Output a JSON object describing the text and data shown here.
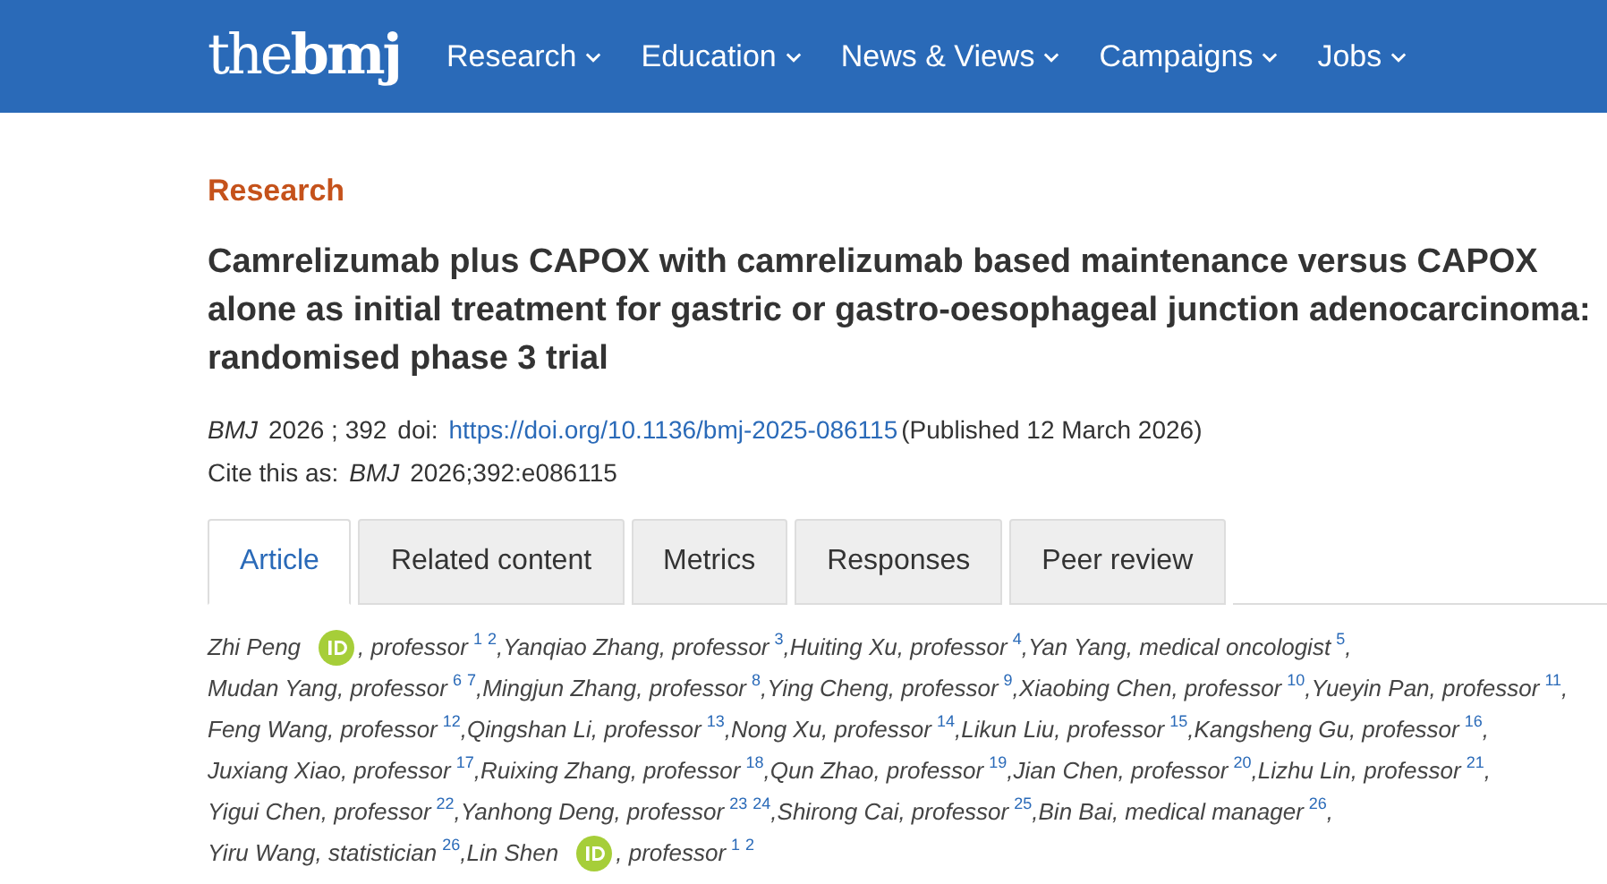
{
  "header": {
    "logo_light": "the",
    "logo_bold": "bmj",
    "nav": [
      {
        "label": "Research"
      },
      {
        "label": "Education"
      },
      {
        "label": "News & Views"
      },
      {
        "label": "Campaigns"
      },
      {
        "label": "Jobs"
      }
    ]
  },
  "article": {
    "section": "Research",
    "title_lines": [
      "Camrelizumab plus CAPOX with camrelizumab based maintenance versus CAPOX",
      "alone as initial treatment for gastric or gastro-oesophageal junction adenocarcinoma:",
      "randomised phase 3 trial"
    ],
    "citation": {
      "journal": "BMJ",
      "volume": "2026 ; 392",
      "doi_label": "doi:",
      "doi": "https://doi.org/10.1136/bmj-2025-086115",
      "published": "(Published 12 March 2026)"
    },
    "cite_as": {
      "label": "Cite this as:",
      "journal": "BMJ",
      "ref": "2026;392:e086115"
    },
    "tabs": [
      {
        "label": "Article",
        "selected": true
      },
      {
        "label": "Related content",
        "selected": false
      },
      {
        "label": "Metrics",
        "selected": false
      },
      {
        "label": "Responses",
        "selected": false
      },
      {
        "label": "Peer review",
        "selected": false
      }
    ],
    "author_lines": [
      [
        {
          "name": "Zhi Peng",
          "orcid": true,
          "role": ", professor",
          "sups": [
            "1",
            "2"
          ],
          "sep": ","
        },
        {
          "name": "Yanqiao Zhang, professor",
          "orcid": false,
          "sups": [
            "3"
          ],
          "sep": ","
        },
        {
          "name": "Huiting Xu, professor",
          "orcid": false,
          "sups": [
            "4"
          ],
          "sep": ","
        },
        {
          "name": "Yan Yang, medical oncologist",
          "orcid": false,
          "sups": [
            "5"
          ],
          "sep": ","
        }
      ],
      [
        {
          "name": "Mudan Yang, professor",
          "orcid": false,
          "sups": [
            "6",
            "7"
          ],
          "sep": ","
        },
        {
          "name": "Mingjun Zhang, professor",
          "orcid": false,
          "sups": [
            "8"
          ],
          "sep": ","
        },
        {
          "name": "Ying Cheng, professor",
          "orcid": false,
          "sups": [
            "9"
          ],
          "sep": ","
        },
        {
          "name": "Xiaobing Chen, professor",
          "orcid": false,
          "sups": [
            "10"
          ],
          "sep": ","
        },
        {
          "name": "Yueyin Pan, professor",
          "orcid": false,
          "sups": [
            "11"
          ],
          "sep": ","
        }
      ],
      [
        {
          "name": "Feng Wang, professor",
          "orcid": false,
          "sups": [
            "12"
          ],
          "sep": ","
        },
        {
          "name": "Qingshan Li, professor",
          "orcid": false,
          "sups": [
            "13"
          ],
          "sep": ","
        },
        {
          "name": "Nong Xu, professor",
          "orcid": false,
          "sups": [
            "14"
          ],
          "sep": ","
        },
        {
          "name": "Likun Liu, professor",
          "orcid": false,
          "sups": [
            "15"
          ],
          "sep": ","
        },
        {
          "name": "Kangsheng Gu, professor",
          "orcid": false,
          "sups": [
            "16"
          ],
          "sep": ","
        }
      ],
      [
        {
          "name": "Juxiang Xiao, professor",
          "orcid": false,
          "sups": [
            "17"
          ],
          "sep": ","
        },
        {
          "name": "Ruixing Zhang, professor",
          "orcid": false,
          "sups": [
            "18"
          ],
          "sep": ","
        },
        {
          "name": "Qun Zhao, professor",
          "orcid": false,
          "sups": [
            "19"
          ],
          "sep": ","
        },
        {
          "name": "Jian Chen, professor",
          "orcid": false,
          "sups": [
            "20"
          ],
          "sep": ","
        },
        {
          "name": "Lizhu Lin, professor",
          "orcid": false,
          "sups": [
            "21"
          ],
          "sep": ","
        }
      ],
      [
        {
          "name": "Yigui Chen, professor",
          "orcid": false,
          "sups": [
            "22"
          ],
          "sep": ","
        },
        {
          "name": "Yanhong Deng, professor",
          "orcid": false,
          "sups": [
            "23",
            "24"
          ],
          "sep": ","
        },
        {
          "name": "Shirong Cai, professor",
          "orcid": false,
          "sups": [
            "25"
          ],
          "sep": ","
        },
        {
          "name": "Bin Bai, medical manager",
          "orcid": false,
          "sups": [
            "26"
          ],
          "sep": ","
        }
      ],
      [
        {
          "name": "Yiru Wang, statistician",
          "orcid": false,
          "sups": [
            "26"
          ],
          "sep": ","
        },
        {
          "name": "Lin Shen",
          "orcid": true,
          "role": ", professor",
          "sups": [
            "1",
            "2"
          ]
        }
      ]
    ]
  }
}
